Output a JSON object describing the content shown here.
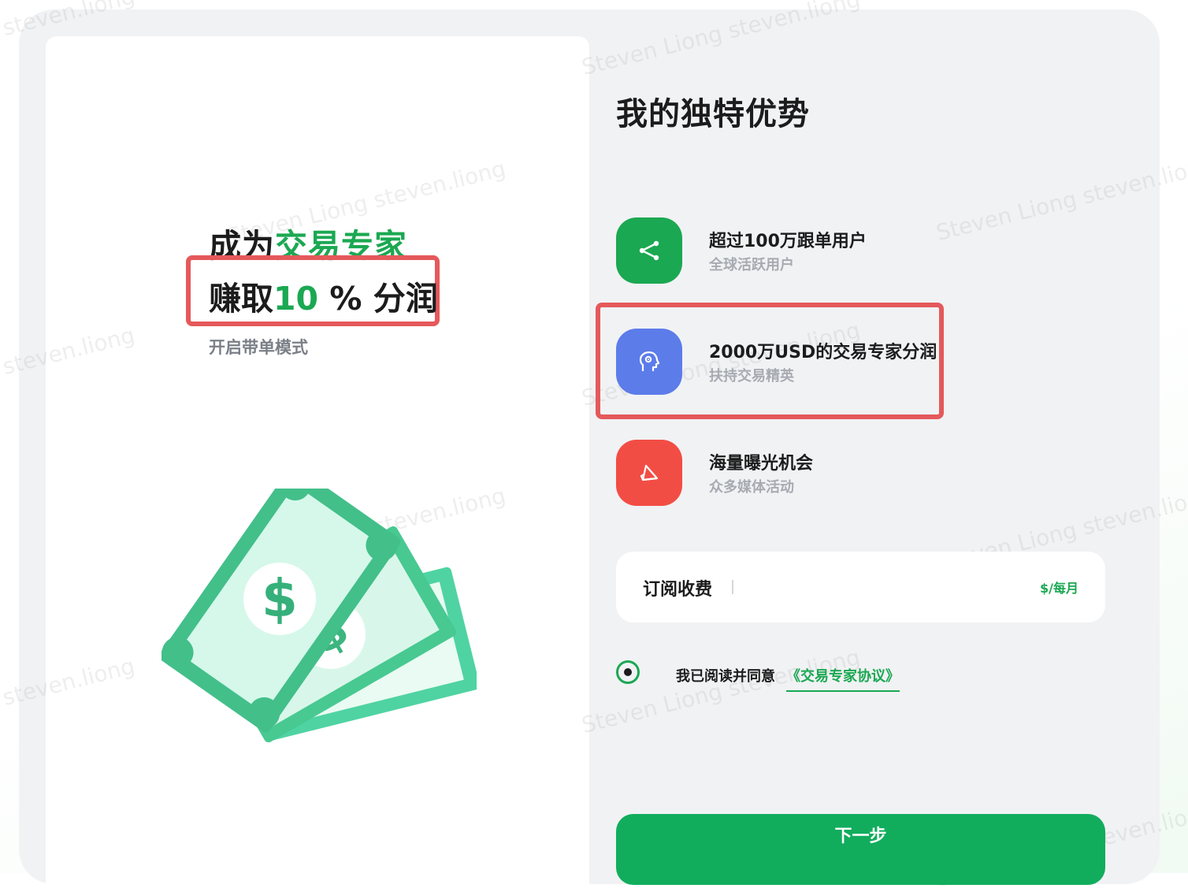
{
  "left": {
    "headline_prefix": "成为",
    "headline_accent": "交易专家",
    "earn_prefix": "赚取",
    "earn_number": "10",
    "earn_suffix": " % 分润",
    "subtitle": "开启带单模式"
  },
  "right": {
    "title": "我的独特优势",
    "features": [
      {
        "title": "超过100万跟单用户",
        "subtitle": "全球活跃用户",
        "icon": "share-icon",
        "color": "#1ba852"
      },
      {
        "title": "2000万USD的交易专家分润",
        "subtitle": "扶持交易精英",
        "icon": "head-gear-icon",
        "color": "#5c7cea"
      },
      {
        "title": "海量曝光机会",
        "subtitle": "众多媒体活动",
        "icon": "megaphone-icon",
        "color": "#f24d45"
      }
    ],
    "fee": {
      "label": "订阅收费",
      "value": "",
      "unit": "$/每月"
    },
    "agreement": {
      "text": "我已阅读并同意",
      "link": "《交易专家协议》",
      "checked": true
    },
    "next_button": "下一步"
  },
  "watermark": {
    "text": "Steven Liong steven.liong",
    "short": "steven.liong"
  },
  "colors": {
    "accent_green": "#1ba852",
    "button_green": "#11ad5d",
    "highlight_red": "#e5595b",
    "blue": "#5c7cea",
    "red": "#f24d45"
  }
}
